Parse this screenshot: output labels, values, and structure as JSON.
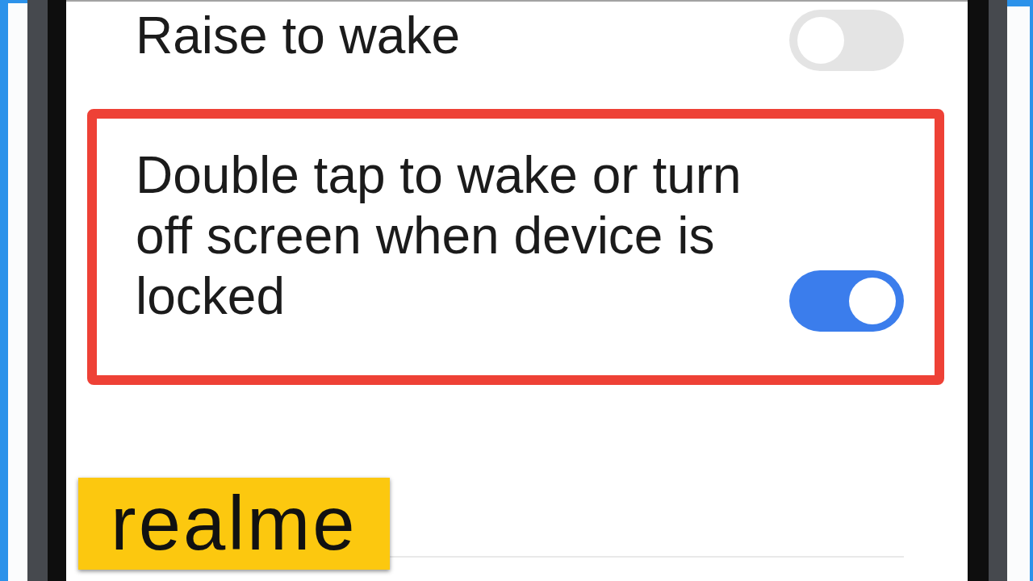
{
  "settings": [
    {
      "label": "Raise to wake",
      "on": false,
      "highlighted": false
    },
    {
      "label": "Double tap to wake or turn off screen when device is locked",
      "on": true,
      "highlighted": true
    }
  ],
  "logo_badge": {
    "text": "realme"
  }
}
